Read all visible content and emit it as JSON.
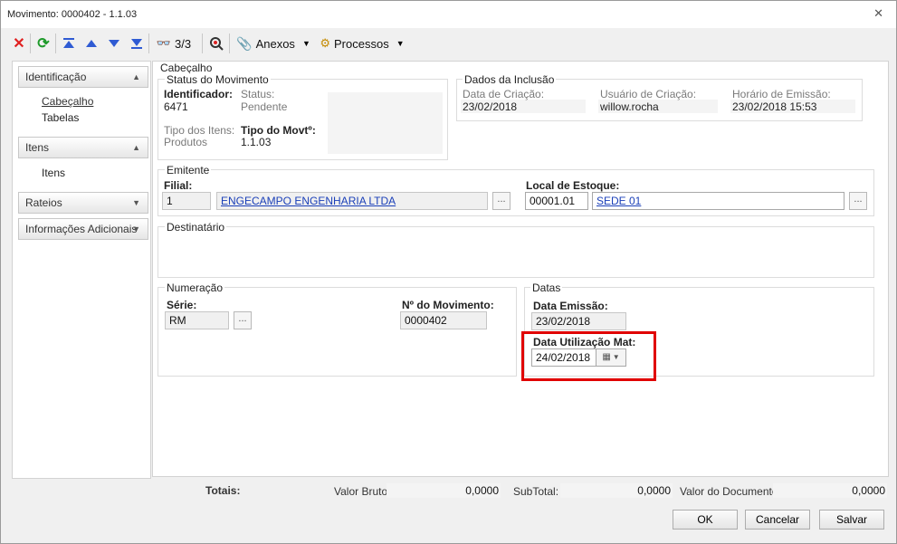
{
  "window": {
    "title": "Movimento: 0000402 - 1.1.03",
    "close_glyph": "✕"
  },
  "toolbar": {
    "delete_icon": "red-x-icon",
    "refresh_icon": "refresh-icon",
    "counter": "3/3",
    "anexos_label": "Anexos",
    "processos_label": "Processos"
  },
  "sidebar": {
    "groups": [
      {
        "label": "Identificação",
        "items": [
          "Cabeçalho",
          "Tabelas"
        ]
      },
      {
        "label": "Itens",
        "items": [
          "Itens"
        ]
      },
      {
        "label": "Rateios"
      },
      {
        "label": "Informações Adicionais"
      }
    ]
  },
  "cabecalho": {
    "section_title": "Cabeçalho",
    "status_group": {
      "title": "Status do Movimento",
      "identificador_label": "Identificador:",
      "identificador_value": "6471",
      "status_label": "Status:",
      "status_value": "Pendente",
      "tipo_itens_label": "Tipo dos Itens:",
      "tipo_itens_value": "Produtos",
      "tipo_movto_label": "Tipo do Movtº:",
      "tipo_movto_value": "1.1.03"
    },
    "inclusao_group": {
      "title": "Dados da Inclusão",
      "data_criacao_label": "Data de Criação:",
      "data_criacao_value": "23/02/2018",
      "usuario_label": "Usuário de Criação:",
      "usuario_value": "willow.rocha",
      "horario_label": "Horário de Emissão:",
      "horario_value": "23/02/2018 15:53"
    },
    "emitente_group": {
      "title": "Emitente",
      "filial_label": "Filial:",
      "filial_code": "1",
      "filial_name": "ENGECAMPO ENGENHARIA LTDA",
      "local_label": "Local de Estoque:",
      "local_code": "00001.01",
      "local_name": "SEDE 01",
      "browse": "..."
    },
    "destinatario_group": {
      "title": "Destinatário"
    },
    "numeracao_group": {
      "title": "Numeração",
      "serie_label": "Série:",
      "serie_value": "RM",
      "numero_label": "Nº do Movimento:",
      "numero_value": "0000402",
      "browse": "..."
    },
    "datas_group": {
      "title": "Datas",
      "emissao_label": "Data Emissão:",
      "emissao_value": "23/02/2018",
      "utilizacao_label": "Data Utilização Mat:",
      "utilizacao_value": "24/02/2018"
    }
  },
  "totals": {
    "label": "Totais:",
    "valor_bruto_label": "Valor Bruto:",
    "valor_bruto": "0,0000",
    "subtotal_label": "SubTotal:",
    "subtotal": "0,0000",
    "valor_doc_label": "Valor do Documento:",
    "valor_doc": "0,0000"
  },
  "buttons": {
    "ok": "OK",
    "cancel": "Cancelar",
    "save": "Salvar"
  },
  "colors": {
    "highlight": "#e00000",
    "link": "#1a3fb8"
  }
}
